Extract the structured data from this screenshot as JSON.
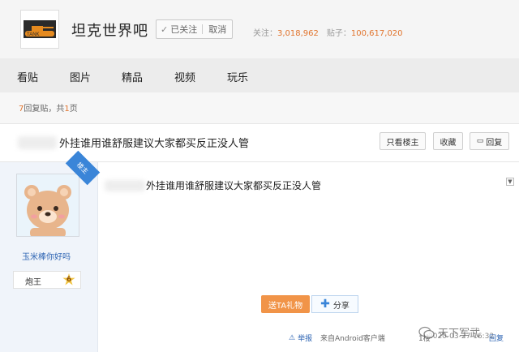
{
  "header": {
    "logo_text": "TANK",
    "forum_title": "坦克世界吧",
    "follow_label": "已关注",
    "cancel_label": "取消",
    "followers_label": "关注：",
    "followers_count": "3,018,962",
    "posts_label": "贴子：",
    "posts_count": "100,617,020"
  },
  "nav": {
    "items": [
      "看贴",
      "图片",
      "精品",
      "视频",
      "玩乐"
    ]
  },
  "pager": {
    "reply_count": "7",
    "reply_suffix": "回复贴，共",
    "page_count": "1",
    "page_suffix": "页"
  },
  "thread": {
    "title": "外挂谁用谁舒服建议大家都买反正没人管",
    "only_op_label": "只看楼主",
    "favorite_label": "收藏",
    "reply_label": "回复"
  },
  "post": {
    "op_badge": "楼主",
    "username": "玉米棒你好吗",
    "level_name": "炮王",
    "level_number": "6",
    "content": "外挂谁用谁舒服建议大家都买反正没人管",
    "gift_label": "送TA礼物",
    "share_label": "分享",
    "report_label": "举报",
    "source": "来自Android客户端",
    "floor": "1楼",
    "date": "2020-03-27 16:32",
    "reply_label": "回复"
  },
  "watermark": {
    "text": "天下军武"
  },
  "colors": {
    "accent_orange": "#e1742d",
    "link_blue": "#2d64b3",
    "gift_orange": "#f19448"
  }
}
